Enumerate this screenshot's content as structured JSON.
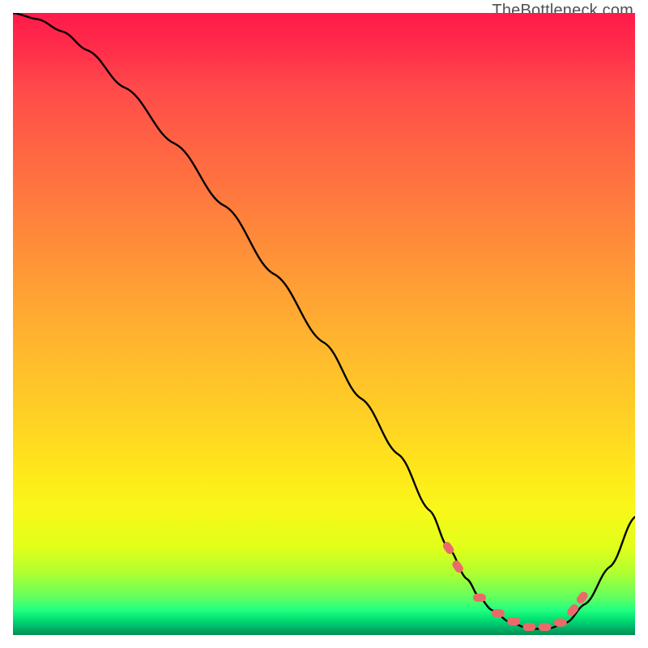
{
  "attribution": "TheBottleneck.com",
  "chart_data": {
    "type": "line",
    "title": "",
    "xlabel": "",
    "ylabel": "",
    "xlim": [
      0,
      100
    ],
    "ylim": [
      0,
      100
    ],
    "background_gradient": {
      "0": "#ff1a4a",
      "50": "#ffb82e",
      "80": "#f8f81a",
      "96": "#20ff80",
      "100": "#009050"
    },
    "grid": false,
    "legend": false,
    "annotations": [
      "TheBottleneck.com"
    ],
    "series": [
      {
        "name": "bottleneck-curve",
        "type": "line",
        "color": "#000000",
        "x": [
          0,
          4,
          8,
          12,
          18,
          26,
          34,
          42,
          50,
          56,
          62,
          67,
          70,
          73,
          75,
          77,
          80,
          83,
          86,
          89,
          92,
          96,
          100
        ],
        "y": [
          100,
          99,
          97,
          94,
          88,
          79,
          69,
          58,
          47,
          38,
          29,
          20,
          14,
          9,
          6,
          4,
          2,
          1,
          1,
          2,
          5,
          11,
          19
        ]
      },
      {
        "name": "valley-markers",
        "type": "scatter",
        "color": "#ea6a6a",
        "shape": "rounded-rect",
        "x": [
          70,
          71.5,
          75,
          78,
          80.5,
          83,
          85.5,
          88,
          90,
          91.5
        ],
        "y": [
          14,
          11,
          6,
          3.5,
          2.2,
          1.3,
          1.3,
          2.0,
          4.0,
          6.0
        ]
      }
    ]
  }
}
